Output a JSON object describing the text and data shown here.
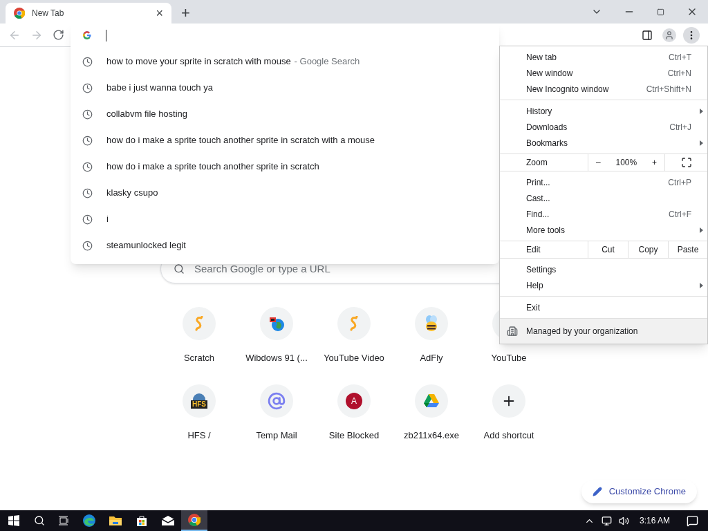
{
  "tab": {
    "title": "New Tab",
    "close": "×",
    "new_tab": "+"
  },
  "omnibox": {
    "suggestions": [
      {
        "text": "how to move your sprite in scratch with mouse",
        "suffix": "- Google Search"
      },
      {
        "text": "babe i just wanna touch ya"
      },
      {
        "text": "collabvm file hosting"
      },
      {
        "text": "how do i make a sprite touch another sprite in scratch with a mouse"
      },
      {
        "text": "how do i make a sprite touch another sprite in scratch"
      },
      {
        "text": "klasky csupo"
      },
      {
        "text": "i"
      },
      {
        "text": "steamunlocked legit"
      }
    ]
  },
  "search": {
    "placeholder": "Search Google or type a URL"
  },
  "shortcuts": [
    {
      "label": "Scratch",
      "kind": "scratch"
    },
    {
      "label": "Wibdows 91 (...",
      "kind": "globe"
    },
    {
      "label": "YouTube Video",
      "kind": "scratch"
    },
    {
      "label": "AdFly",
      "kind": "bee"
    },
    {
      "label": "YouTube",
      "kind": "covered"
    },
    {
      "label": "HFS /",
      "kind": "hfs",
      "icon_text": "HFS"
    },
    {
      "label": "Temp Mail",
      "kind": "at"
    },
    {
      "label": "Site Blocked",
      "kind": "letter",
      "icon_text": "A"
    },
    {
      "label": "zb211x64.exe",
      "kind": "drive"
    },
    {
      "label": "Add shortcut",
      "kind": "add"
    }
  ],
  "customize": {
    "label": "Customize Chrome"
  },
  "menu": {
    "sections": [
      [
        {
          "kind": "item",
          "label": "New tab",
          "shortcut": "Ctrl+T",
          "submenu": false
        },
        {
          "kind": "item",
          "label": "New window",
          "shortcut": "Ctrl+N",
          "submenu": false
        },
        {
          "kind": "item",
          "label": "New Incognito window",
          "shortcut": "Ctrl+Shift+N",
          "submenu": false
        }
      ],
      [
        {
          "kind": "item",
          "label": "History",
          "submenu": true
        },
        {
          "kind": "item",
          "label": "Downloads",
          "shortcut": "Ctrl+J",
          "submenu": false
        },
        {
          "kind": "item",
          "label": "Bookmarks",
          "submenu": true
        }
      ],
      [
        {
          "kind": "zoom",
          "label": "Zoom",
          "minus": "–",
          "value": "100%",
          "plus": "+"
        }
      ],
      [
        {
          "kind": "item",
          "label": "Print...",
          "shortcut": "Ctrl+P",
          "submenu": false
        },
        {
          "kind": "item",
          "label": "Cast...",
          "submenu": false
        },
        {
          "kind": "item",
          "label": "Find...",
          "shortcut": "Ctrl+F",
          "submenu": false
        },
        {
          "kind": "item",
          "label": "More tools",
          "submenu": true
        }
      ],
      [
        {
          "kind": "edit",
          "label": "Edit",
          "cut": "Cut",
          "copy": "Copy",
          "paste": "Paste"
        }
      ],
      [
        {
          "kind": "item",
          "label": "Settings",
          "submenu": false
        },
        {
          "kind": "item",
          "label": "Help",
          "submenu": true
        }
      ],
      [
        {
          "kind": "item",
          "label": "Exit",
          "submenu": false
        }
      ],
      [
        {
          "kind": "managed",
          "label": "Managed by your organization"
        }
      ]
    ]
  },
  "taskbar": {
    "clock": "3:16 AM",
    "apps": [
      {
        "kind": "edge",
        "selected": false
      },
      {
        "kind": "folder",
        "selected": false
      },
      {
        "kind": "store",
        "selected": false
      },
      {
        "kind": "mail",
        "selected": false
      },
      {
        "kind": "chrome",
        "selected": true
      }
    ]
  }
}
